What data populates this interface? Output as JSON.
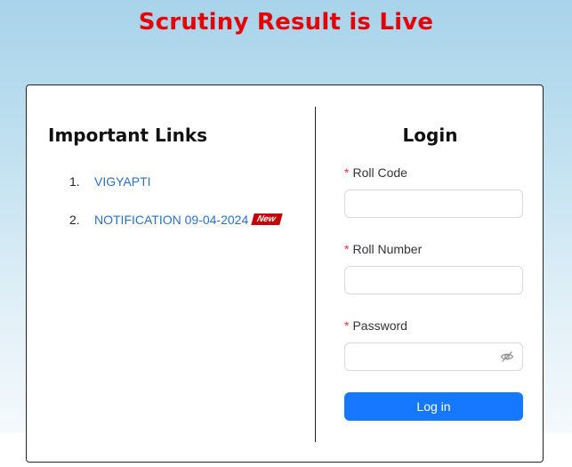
{
  "banner": {
    "text": "Scrutiny Result is Live"
  },
  "links": {
    "title": "Important Links",
    "items": [
      {
        "number": "1.",
        "label": "VIGYAPTI",
        "badge": ""
      },
      {
        "number": "2.",
        "label": "NOTIFICATION 09-04-2024",
        "badge": "New"
      }
    ]
  },
  "login": {
    "title": "Login",
    "required_mark": "*",
    "roll_code_label": "Roll Code",
    "roll_code_value": "",
    "roll_number_label": "Roll Number",
    "roll_number_value": "",
    "password_label": "Password",
    "password_value": "",
    "password_toggle_icon": "eye-invisible-icon",
    "submit_label": "Log in"
  },
  "colors": {
    "banner_text": "#e60000",
    "link": "#2e6fbf",
    "badge_bg": "#c40000",
    "required_mark": "#d9363e",
    "primary_button": "#1677ff"
  }
}
